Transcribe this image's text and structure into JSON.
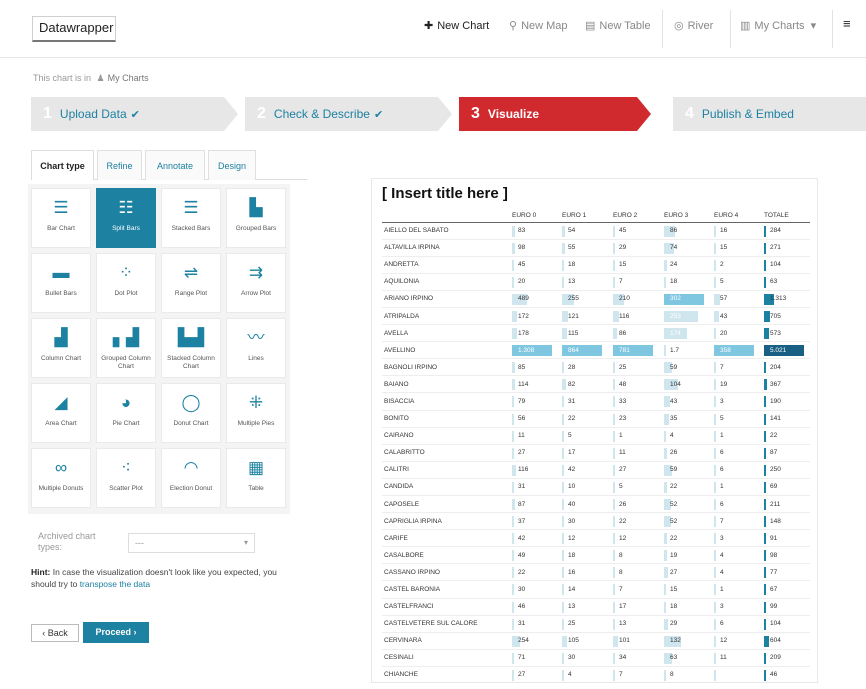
{
  "header": {
    "logo": "Datawrapper",
    "new_chart": "New Chart",
    "new_map": "New Map",
    "new_table": "New Table",
    "river": "River",
    "my_charts": "My Charts"
  },
  "breadcrumb": {
    "prefix": "This chart is in",
    "folder": "My Charts"
  },
  "steps": [
    {
      "num": "1",
      "label": "Upload Data"
    },
    {
      "num": "2",
      "label": "Check & Describe"
    },
    {
      "num": "3",
      "label": "Visualize"
    },
    {
      "num": "4",
      "label": "Publish & Embed"
    }
  ],
  "tabs": [
    "Chart type",
    "Refine",
    "Annotate",
    "Design"
  ],
  "chart_types": [
    {
      "label": "Bar Chart",
      "icon": "bar-chart-icon"
    },
    {
      "label": "Split Bars",
      "icon": "split-bars-icon"
    },
    {
      "label": "Stacked Bars",
      "icon": "stacked-bars-icon"
    },
    {
      "label": "Grouped Bars",
      "icon": "grouped-bars-icon"
    },
    {
      "label": "Bullet Bars",
      "icon": "bullet-bars-icon"
    },
    {
      "label": "Dot Plot",
      "icon": "dot-plot-icon"
    },
    {
      "label": "Range Plot",
      "icon": "range-plot-icon"
    },
    {
      "label": "Arrow Plot",
      "icon": "arrow-plot-icon"
    },
    {
      "label": "Column Chart",
      "icon": "column-chart-icon"
    },
    {
      "label": "Grouped Column Chart",
      "icon": "grouped-column-icon"
    },
    {
      "label": "Stacked Column Chart",
      "icon": "stacked-column-icon"
    },
    {
      "label": "Lines",
      "icon": "lines-icon"
    },
    {
      "label": "Area Chart",
      "icon": "area-chart-icon"
    },
    {
      "label": "Pie Chart",
      "icon": "pie-chart-icon"
    },
    {
      "label": "Donut Chart",
      "icon": "donut-chart-icon"
    },
    {
      "label": "Multiple Pies",
      "icon": "multiple-pies-icon"
    },
    {
      "label": "Multiple Donuts",
      "icon": "multiple-donuts-icon"
    },
    {
      "label": "Scatter Plot",
      "icon": "scatter-plot-icon"
    },
    {
      "label": "Election Donut",
      "icon": "election-donut-icon"
    },
    {
      "label": "Table",
      "icon": "table-icon"
    }
  ],
  "archived": {
    "label": "Archived chart types:",
    "value": "---"
  },
  "hint": {
    "bold": "Hint:",
    "text": "In case the visualization doesn't look like you expected, you should try to",
    "link": "transpose the data"
  },
  "buttons": {
    "back": "Back",
    "proceed": "Proceed"
  },
  "preview": {
    "title": "[ Insert title here ]",
    "columns": [
      "",
      "EURO 0",
      "EURO 1",
      "EURO 2",
      "EURO 3",
      "EURO 4",
      "TOTALE"
    ],
    "rows": [
      [
        "AIELLO DEL SABATO",
        "83",
        "54",
        "45",
        "86",
        "16",
        "284"
      ],
      [
        "ALTAVILLA IRPINA",
        "98",
        "55",
        "29",
        "74",
        "15",
        "271"
      ],
      [
        "ANDRETTA",
        "45",
        "18",
        "15",
        "24",
        "2",
        "104"
      ],
      [
        "AQUILONIA",
        "20",
        "13",
        "7",
        "18",
        "5",
        "63"
      ],
      [
        "ARIANO IRPINO",
        "489",
        "255",
        "210",
        "302",
        "57",
        "1.313"
      ],
      [
        "ATRIPALDA",
        "172",
        "121",
        "116",
        "253",
        "43",
        "705"
      ],
      [
        "AVELLA",
        "178",
        "115",
        "86",
        "174",
        "20",
        "573"
      ],
      [
        "AVELLINO",
        "1.308",
        "864",
        "781",
        "1.7",
        "358",
        "5.021"
      ],
      [
        "BAGNOLI IRPINO",
        "85",
        "28",
        "25",
        "59",
        "7",
        "204"
      ],
      [
        "BAIANO",
        "114",
        "82",
        "48",
        "104",
        "19",
        "367"
      ],
      [
        "BISACCIA",
        "79",
        "31",
        "33",
        "43",
        "3",
        "190"
      ],
      [
        "BONITO",
        "56",
        "22",
        "23",
        "35",
        "5",
        "141"
      ],
      [
        "CAIRANO",
        "11",
        "5",
        "1",
        "4",
        "1",
        "22"
      ],
      [
        "CALABRITTO",
        "27",
        "17",
        "11",
        "26",
        "6",
        "87"
      ],
      [
        "CALITRI",
        "116",
        "42",
        "27",
        "59",
        "6",
        "250"
      ],
      [
        "CANDIDA",
        "31",
        "10",
        "5",
        "22",
        "1",
        "69"
      ],
      [
        "CAPOSELE",
        "87",
        "40",
        "26",
        "52",
        "6",
        "211"
      ],
      [
        "CAPRIGLIA IRPINA",
        "37",
        "30",
        "22",
        "52",
        "7",
        "148"
      ],
      [
        "CARIFE",
        "42",
        "12",
        "12",
        "22",
        "3",
        "91"
      ],
      [
        "CASALBORE",
        "49",
        "18",
        "8",
        "19",
        "4",
        "98"
      ],
      [
        "CASSANO IRPINO",
        "22",
        "16",
        "8",
        "27",
        "4",
        "77"
      ],
      [
        "CASTEL BARONIA",
        "30",
        "14",
        "7",
        "15",
        "1",
        "67"
      ],
      [
        "CASTELFRANCI",
        "46",
        "13",
        "17",
        "18",
        "3",
        "99"
      ],
      [
        "CASTELVETERE SUL CALORE",
        "31",
        "25",
        "13",
        "29",
        "6",
        "104"
      ],
      [
        "CERVINARA",
        "254",
        "105",
        "101",
        "132",
        "12",
        "604"
      ],
      [
        "CESINALI",
        "71",
        "30",
        "34",
        "63",
        "11",
        "209"
      ],
      [
        "CHIANCHE",
        "27",
        "4",
        "7",
        "8",
        "",
        "46"
      ]
    ]
  },
  "colors": {
    "accent": "#1d81a2",
    "active_step": "#d02a2f"
  }
}
